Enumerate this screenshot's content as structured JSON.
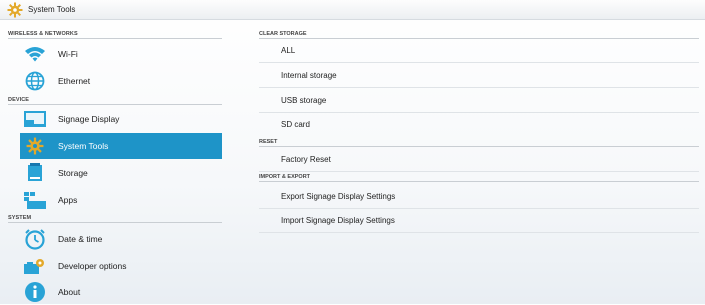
{
  "titlebar": {
    "title": "System Tools",
    "icon": "gear-icon"
  },
  "left": {
    "sections": [
      {
        "label": "WIRELESS & NETWORKS"
      },
      {
        "label": "DEVICE"
      },
      {
        "label": "SYSTEM"
      }
    ],
    "items": [
      {
        "label": "Wi-Fi",
        "icon": "wifi-icon"
      },
      {
        "label": "Ethernet",
        "icon": "ethernet-globe-icon"
      },
      {
        "label": "Signage Display",
        "icon": "display-icon"
      },
      {
        "label": "System Tools",
        "icon": "gear-icon",
        "selected": true
      },
      {
        "label": "Storage",
        "icon": "storage-icon"
      },
      {
        "label": "Apps",
        "icon": "apps-icon"
      },
      {
        "label": "Date & time",
        "icon": "clock-icon"
      },
      {
        "label": "Developer options",
        "icon": "developer-options-icon"
      },
      {
        "label": "About",
        "icon": "info-icon"
      }
    ]
  },
  "right": {
    "sections": [
      {
        "label": "CLEAR STORAGE"
      },
      {
        "label": "RESET"
      },
      {
        "label": "IMPORT & EXPORT"
      }
    ],
    "items": [
      {
        "label": "ALL"
      },
      {
        "label": "Internal storage"
      },
      {
        "label": "USB storage"
      },
      {
        "label": "SD card"
      },
      {
        "label": "Factory Reset"
      },
      {
        "label": "Export Signage Display Settings"
      },
      {
        "label": "Import Signage Display Settings"
      }
    ]
  },
  "colors": {
    "accent": "#1e94c8",
    "icon": "#29a3d6",
    "icon_dark": "#1678b0"
  }
}
